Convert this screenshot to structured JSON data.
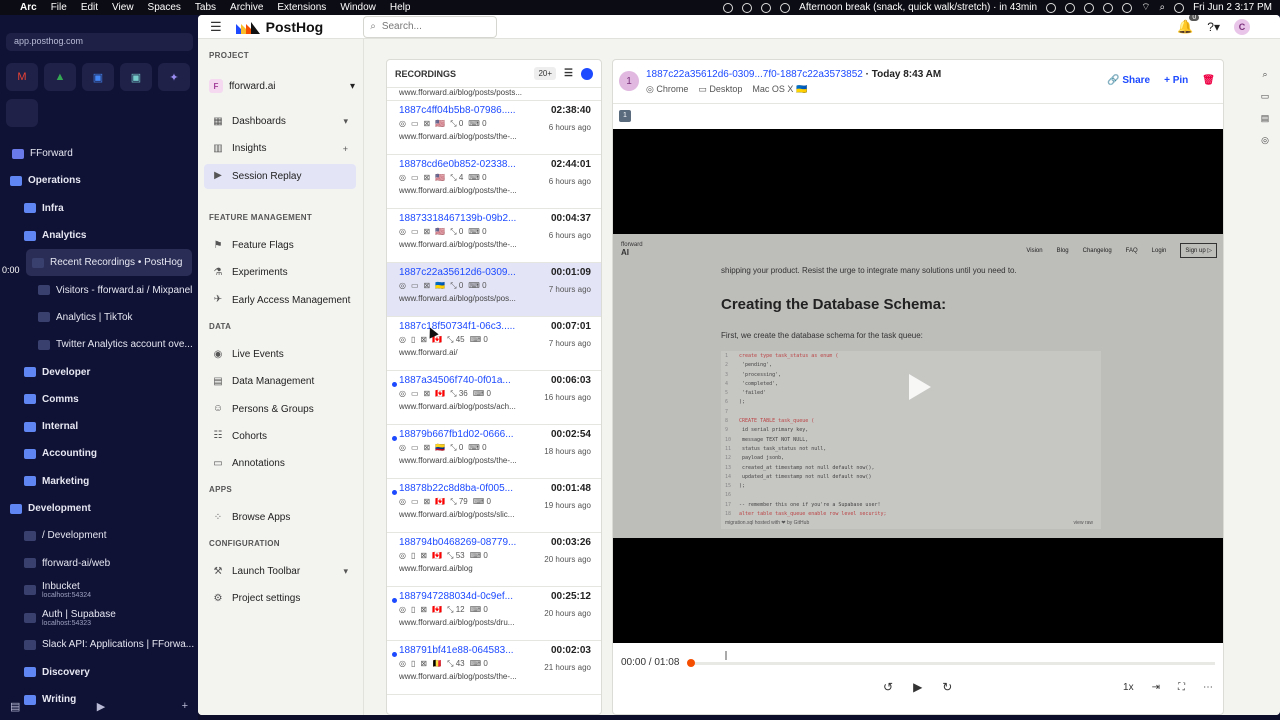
{
  "menubar": {
    "app": "Arc",
    "menus": [
      "File",
      "Edit",
      "View",
      "Spaces",
      "Tabs",
      "Archive",
      "Extensions",
      "Window",
      "Help"
    ],
    "reminder": "Afternoon break (snack, quick walk/stretch) · in 43min",
    "datetime": "Fri Jun 2  3:17 PM"
  },
  "arc": {
    "url": "app.posthog.com",
    "side_time": "0:00",
    "tabs": [
      {
        "label": "FForward",
        "kind": "space"
      },
      {
        "label": "Operations",
        "kind": "folder",
        "indent": 0
      },
      {
        "label": "Infra",
        "kind": "folder",
        "indent": 1
      },
      {
        "label": "Analytics",
        "kind": "folder",
        "indent": 1
      },
      {
        "label": "Recent Recordings • PostHog",
        "kind": "tab",
        "indent": 2,
        "selected": true
      },
      {
        "label": "Visitors - fforward.ai / Mixpanel",
        "kind": "tab",
        "indent": 2
      },
      {
        "label": "Analytics | TikTok",
        "kind": "tab",
        "indent": 2
      },
      {
        "label": "Twitter Analytics account ove...",
        "kind": "tab",
        "indent": 2
      },
      {
        "label": "Developer",
        "kind": "folder",
        "indent": 1
      },
      {
        "label": "Comms",
        "kind": "folder",
        "indent": 1
      },
      {
        "label": "Internal",
        "kind": "folder",
        "indent": 1
      },
      {
        "label": "Accounting",
        "kind": "folder",
        "indent": 1
      },
      {
        "label": "Marketing",
        "kind": "folder",
        "indent": 1
      },
      {
        "label": "Development",
        "kind": "folder",
        "indent": 0
      },
      {
        "label": "/ Development",
        "kind": "tab",
        "indent": 1
      },
      {
        "label": "fforward-ai/web",
        "kind": "tab",
        "indent": 1
      },
      {
        "label": "Inbucket",
        "sub": "localhost:54324",
        "kind": "tab",
        "indent": 1
      },
      {
        "label": "Auth | Supabase",
        "sub": "localhost:54323",
        "kind": "tab",
        "indent": 1
      },
      {
        "label": "Slack API: Applications | FForwa...",
        "kind": "tab",
        "indent": 1
      },
      {
        "label": "Discovery",
        "kind": "folder",
        "indent": 1
      },
      {
        "label": "Writing",
        "kind": "folder",
        "indent": 1
      }
    ]
  },
  "topbar": {
    "brand": "PostHog",
    "search_placeholder": "Search...",
    "notif_count": "0",
    "avatar_letter": "C"
  },
  "nav": {
    "project_header": "PROJECT",
    "project_name": "fforward.ai",
    "project_letter": "F",
    "items_main": [
      {
        "label": "Dashboards",
        "icon": "▦",
        "trail": "▾"
      },
      {
        "label": "Insights",
        "icon": "▥",
        "trail": "+"
      },
      {
        "label": "Session Replay",
        "icon": "▶",
        "selected": true
      }
    ],
    "feature_header": "FEATURE MANAGEMENT",
    "items_feature": [
      {
        "label": "Feature Flags",
        "icon": "⚑"
      },
      {
        "label": "Experiments",
        "icon": "⚗"
      },
      {
        "label": "Early Access Management",
        "icon": "✈"
      }
    ],
    "data_header": "DATA",
    "items_data": [
      {
        "label": "Live Events",
        "icon": "◉"
      },
      {
        "label": "Data Management",
        "icon": "▤"
      },
      {
        "label": "Persons & Groups",
        "icon": "☺"
      },
      {
        "label": "Cohorts",
        "icon": "☷"
      },
      {
        "label": "Annotations",
        "icon": "▭"
      }
    ],
    "apps_header": "APPS",
    "items_apps": [
      {
        "label": "Browse Apps",
        "icon": "⁘"
      }
    ],
    "config_header": "CONFIGURATION",
    "items_config": [
      {
        "label": "Launch Toolbar",
        "icon": "⚒",
        "trail": "▾"
      },
      {
        "label": "Project settings",
        "icon": "⚙"
      }
    ]
  },
  "recordings": {
    "title": "RECORDINGS",
    "count": "20+",
    "first_path": "www.fforward.ai/blog/posts/posts...",
    "items": [
      {
        "id": "1887c4ff04b5b8-07986.....",
        "duration": "02:38:40",
        "ago": "6 hours ago",
        "clicks": "0",
        "keys": "0",
        "path": "www.fforward.ai/blog/posts/the-...",
        "flag": "🇺🇸",
        "device": "desktop",
        "unwatched": false
      },
      {
        "id": "18878cd6e0b852-02338...",
        "duration": "02:44:01",
        "ago": "6 hours ago",
        "clicks": "4",
        "keys": "0",
        "path": "www.fforward.ai/blog/posts/the-...",
        "flag": "🇺🇸",
        "device": "desktop",
        "unwatched": false
      },
      {
        "id": "18873318467139b-09b2...",
        "duration": "00:04:37",
        "ago": "6 hours ago",
        "clicks": "0",
        "keys": "0",
        "path": "www.fforward.ai/blog/posts/the-...",
        "flag": "🇺🇸",
        "device": "desktop",
        "unwatched": false
      },
      {
        "id": "1887c22a35612d6-0309...",
        "duration": "00:01:09",
        "ago": "7 hours ago",
        "clicks": "0",
        "keys": "0",
        "path": "www.fforward.ai/blog/posts/pos...",
        "flag": "🇺🇦",
        "device": "desktop",
        "unwatched": false,
        "selected": true
      },
      {
        "id": "1887c18f50734f1-06c3.....",
        "duration": "00:07:01",
        "ago": "7 hours ago",
        "clicks": "45",
        "keys": "0",
        "path": "www.fforward.ai/",
        "flag": "🇨🇦",
        "device": "mobile",
        "unwatched": false
      },
      {
        "id": "1887a34506f740-0f01a...",
        "duration": "00:06:03",
        "ago": "16 hours ago",
        "clicks": "36",
        "keys": "0",
        "path": "www.fforward.ai/blog/posts/ach...",
        "flag": "🇨🇦",
        "device": "desktop",
        "unwatched": true
      },
      {
        "id": "18879b667fb1d02-0666...",
        "duration": "00:02:54",
        "ago": "18 hours ago",
        "clicks": "0",
        "keys": "0",
        "path": "www.fforward.ai/blog/posts/the-...",
        "flag": "🇨🇴",
        "device": "desktop",
        "unwatched": true
      },
      {
        "id": "18878b22c8d8ba-0f005...",
        "duration": "00:01:48",
        "ago": "19 hours ago",
        "clicks": "79",
        "keys": "0",
        "path": "www.fforward.ai/blog/posts/slic...",
        "flag": "🇨🇦",
        "device": "desktop",
        "unwatched": true
      },
      {
        "id": "188794b0468269-08779...",
        "duration": "00:03:26",
        "ago": "20 hours ago",
        "clicks": "53",
        "keys": "0",
        "path": "www.fforward.ai/blog",
        "flag": "🇨🇦",
        "device": "mobile",
        "unwatched": false
      },
      {
        "id": "1887947288034d-0c9ef...",
        "duration": "00:25:12",
        "ago": "20 hours ago",
        "clicks": "12",
        "keys": "0",
        "path": "www.fforward.ai/blog/posts/dru...",
        "flag": "🇨🇦",
        "device": "mobile",
        "unwatched": true
      },
      {
        "id": "188791bf41e88-064583...",
        "duration": "00:02:03",
        "ago": "21 hours ago",
        "clicks": "43",
        "keys": "0",
        "path": "www.fforward.ai/blog/posts/the-...",
        "flag": "🇧🇪",
        "device": "mobile",
        "unwatched": true
      }
    ]
  },
  "player": {
    "avatar": "1",
    "session_id": "1887c22a35612d6-0309...7f0-1887c22a3573852",
    "when": "· Today 8:43 AM",
    "browser": "Chrome",
    "device": "Desktop",
    "os": "Mac OS X",
    "country_flag": "🇺🇦",
    "share_label": "Share",
    "pin_label": "Pin",
    "segment": "1",
    "time_display": "00:00 / 01:08",
    "speed": "1x",
    "progress_fraction": 0.0
  },
  "shot": {
    "brand_small": "fforward",
    "brand_big": "AI",
    "links": [
      "Vision",
      "Blog",
      "Changelog",
      "FAQ",
      "Login"
    ],
    "signup": "Sign up ▷",
    "p1": "shipping your product. Resist the urge to integrate many solutions until you need to.",
    "heading": "Creating the Database Schema:",
    "p2": "First, we create the database schema for the task queue:",
    "code": [
      "create type task_status as enum (",
      "  'pending',",
      "  'processing',",
      "  'completed',",
      "  'failed'",
      ");",
      "",
      "CREATE TABLE task_queue (",
      "  id serial primary key,",
      "  message TEXT NOT NULL,",
      "  status task_status not null,",
      "  payload jsonb,",
      "  created_at timestamp not null default now(),",
      "  updated_at timestamp not null default now()",
      ");",
      "",
      "-- remember this one if you're a Supabase user!",
      "alter table task_queue enable row level security;"
    ],
    "code_footer": "migration.sql hosted with ❤ by GitHub",
    "code_view": "view raw"
  }
}
